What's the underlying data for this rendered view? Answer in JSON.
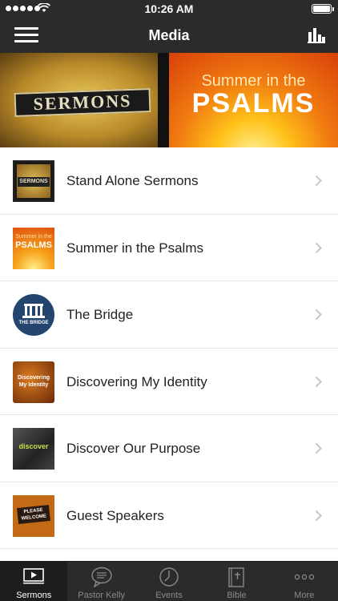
{
  "status_bar": {
    "time": "10:26 AM"
  },
  "nav": {
    "title": "Media"
  },
  "banner": {
    "left_title": "SERMONS",
    "right_line1": "Summer in the",
    "right_line2": "PSALMS"
  },
  "list": {
    "items": [
      {
        "label": "Stand Alone Sermons",
        "thumb_text": "SERMONS"
      },
      {
        "label": "Summer in the Psalms",
        "thumb_text1": "Summer in the",
        "thumb_text2": "PSALMS"
      },
      {
        "label": "The Bridge",
        "thumb_text": "THE BRIDGE"
      },
      {
        "label": "Discovering My Identity",
        "thumb_text": "Discovering My Identity"
      },
      {
        "label": "Discover Our Purpose",
        "thumb_text": "discover"
      },
      {
        "label": "Guest Speakers",
        "thumb_text": "PLEASE WELCOME"
      }
    ]
  },
  "tabs": [
    {
      "label": "Sermons",
      "icon": "play-screen-icon",
      "active": true
    },
    {
      "label": "Pastor Kelly",
      "icon": "speech-bubble-icon"
    },
    {
      "label": "Events",
      "icon": "clock-icon"
    },
    {
      "label": "Bible",
      "icon": "bible-icon"
    },
    {
      "label": "More",
      "icon": "more-dots-icon"
    }
  ],
  "colors": {
    "bar_bg": "#2b2b2b",
    "active_tab_bg": "#1d1d1d",
    "text": "#222222",
    "chevron": "#c7c7cc"
  }
}
